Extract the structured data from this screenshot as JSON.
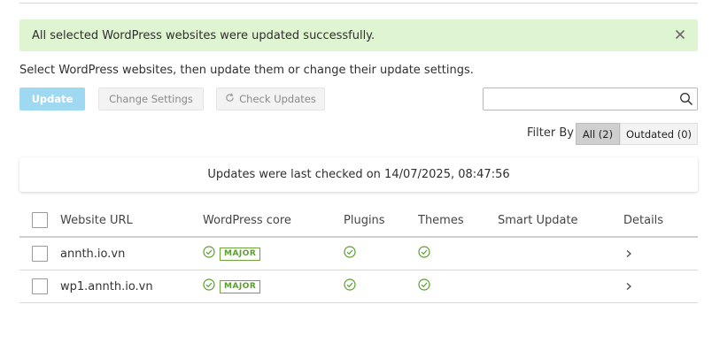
{
  "alert": {
    "message": "All selected WordPress websites were updated successfully."
  },
  "intro_text": "Select WordPress websites, then update them or change their update settings.",
  "toolbar": {
    "update_label": "Update",
    "change_settings_label": "Change Settings",
    "check_updates_label": "Check Updates"
  },
  "search": {
    "value": "",
    "placeholder": ""
  },
  "filter": {
    "label": "Filter By",
    "options": [
      "All (2)",
      "Outdated (0)"
    ],
    "selected": "All (2)"
  },
  "last_checked_text": "Updates were last checked on 14/07/2025, 08:47:56",
  "table": {
    "columns": [
      "Website URL",
      "WordPress core",
      "Plugins",
      "Themes",
      "Smart Update",
      "Details"
    ],
    "rows": [
      {
        "url": "annth.io.vn",
        "core_badge": "MAJOR"
      },
      {
        "url": "wp1.annth.io.vn",
        "core_badge": "MAJOR"
      }
    ]
  },
  "colors": {
    "alert_bg": "#dff4d1",
    "update_button": "#9fd8f1",
    "ok_green": "#5a9e2f"
  },
  "icons": [
    "close-icon",
    "refresh-icon",
    "search-icon",
    "check-circle-icon",
    "chevron-right-icon"
  ]
}
